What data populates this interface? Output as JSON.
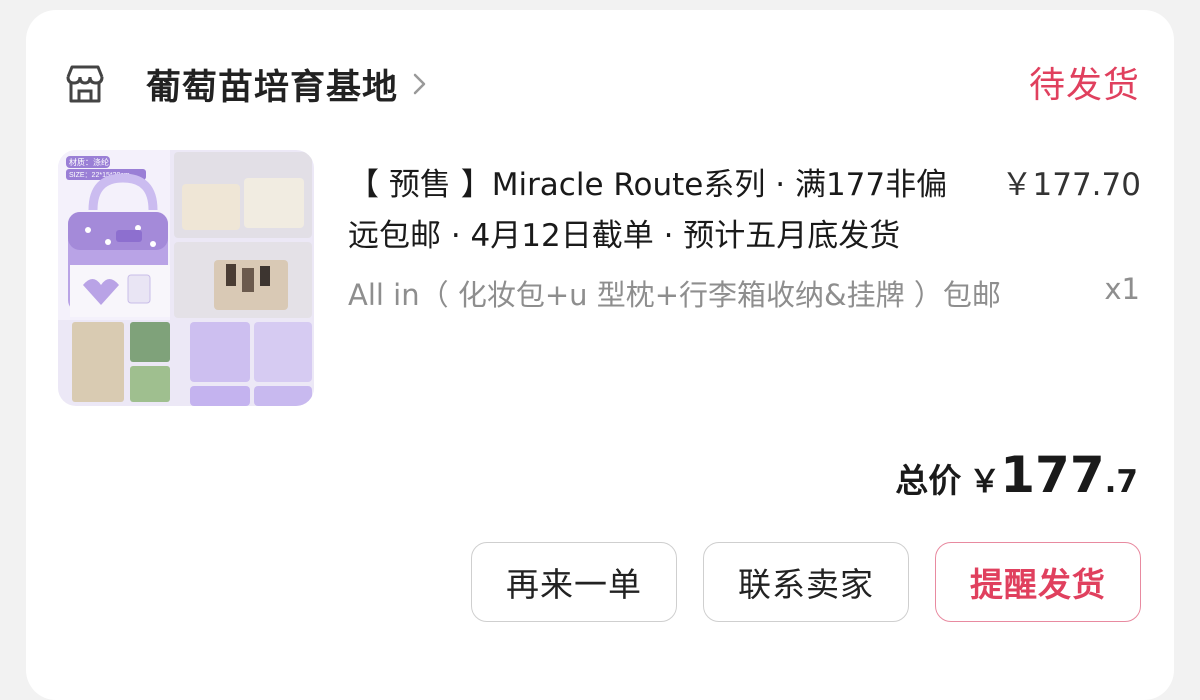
{
  "shop": {
    "name": "葡萄苗培育基地",
    "icon": "shop-icon",
    "status": "待发货"
  },
  "item": {
    "title": "【 预售 】Miracle Route系列 · 满177非偏远包邮 · 4月12日截单 · 预计五月底发货",
    "unit_price": "￥177.70",
    "variant": "All in（ 化妆包+u 型枕+行李箱收纳&挂牌 ）包邮",
    "quantity": "x1",
    "thumbnail": {
      "tag": "材质：涤纶",
      "size": "SIZE：22*15*20cm",
      "accent": "#b9a3e6"
    }
  },
  "total": {
    "label": "总价",
    "currency": "￥",
    "integer": "177",
    "decimal": ".7"
  },
  "actions": {
    "reorder": "再来一单",
    "contact": "联系卖家",
    "remind": "提醒发货"
  },
  "colors": {
    "accent": "#e0405e",
    "muted": "#8e8e8e"
  }
}
